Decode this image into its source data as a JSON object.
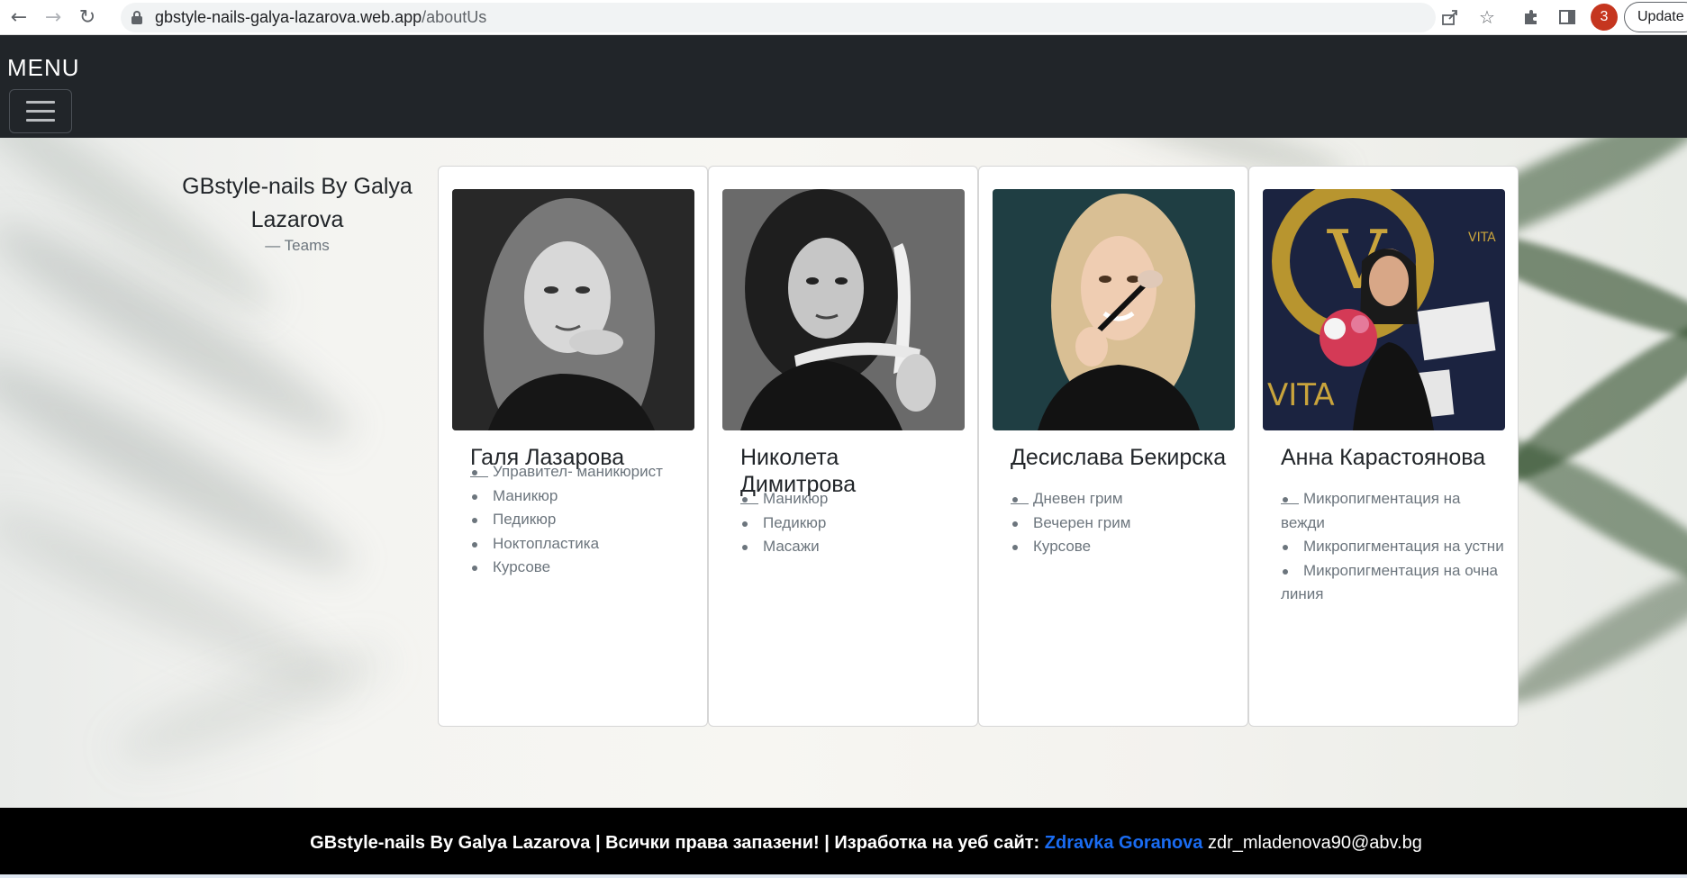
{
  "browser": {
    "url_host": "gbstyle-nails-galya-lazarova.web.app",
    "url_path": "/aboutUs",
    "profile_badge": "3",
    "update_label": "Update",
    "icons": [
      "back-arrow-icon",
      "forward-arrow-icon",
      "reload-icon",
      "lock-icon",
      "share-icon",
      "bookmark-star-icon",
      "extensions-puzzle-icon",
      "side-panel-icon"
    ]
  },
  "navbar": {
    "menu_label": "MENU",
    "toggler_icon": "hamburger-icon"
  },
  "hero": {
    "title": "GBstyle-nails By Galya Lazarova",
    "subtitle": "— Teams"
  },
  "team": [
    {
      "name": "Галя Лазарова",
      "dash": "—",
      "skills": [
        "Управител- маникюрист",
        "Маникюр",
        "Педикюр",
        "Ноктопластика",
        "Курсове"
      ]
    },
    {
      "name": "Николета Димитрова",
      "dash": "—",
      "skills": [
        "Маникюр",
        "Педикюр",
        "Масажи"
      ]
    },
    {
      "name": "Десислава Бекирска",
      "dash": "—",
      "skills": [
        "Дневен грим",
        "Вечерен грим",
        "Курсове"
      ]
    },
    {
      "name": "Анна Карастоянова",
      "dash": "—",
      "skills": [
        "Микропигментация на вежди",
        "Микропигментация на устни",
        "Микропигментация на очна линия"
      ]
    }
  ],
  "footer": {
    "text": "GBstyle-nails By Galya Lazarova | Всички права запазени! | Изработка на уеб сайт:",
    "author": "Zdravka Goranova",
    "email": "zdr_mladenova90@abv.bg"
  },
  "colors": {
    "navbar_bg": "#212529",
    "footer_bg": "#000000",
    "author_link": "#1a6cf2",
    "text_muted": "#6c757d"
  }
}
